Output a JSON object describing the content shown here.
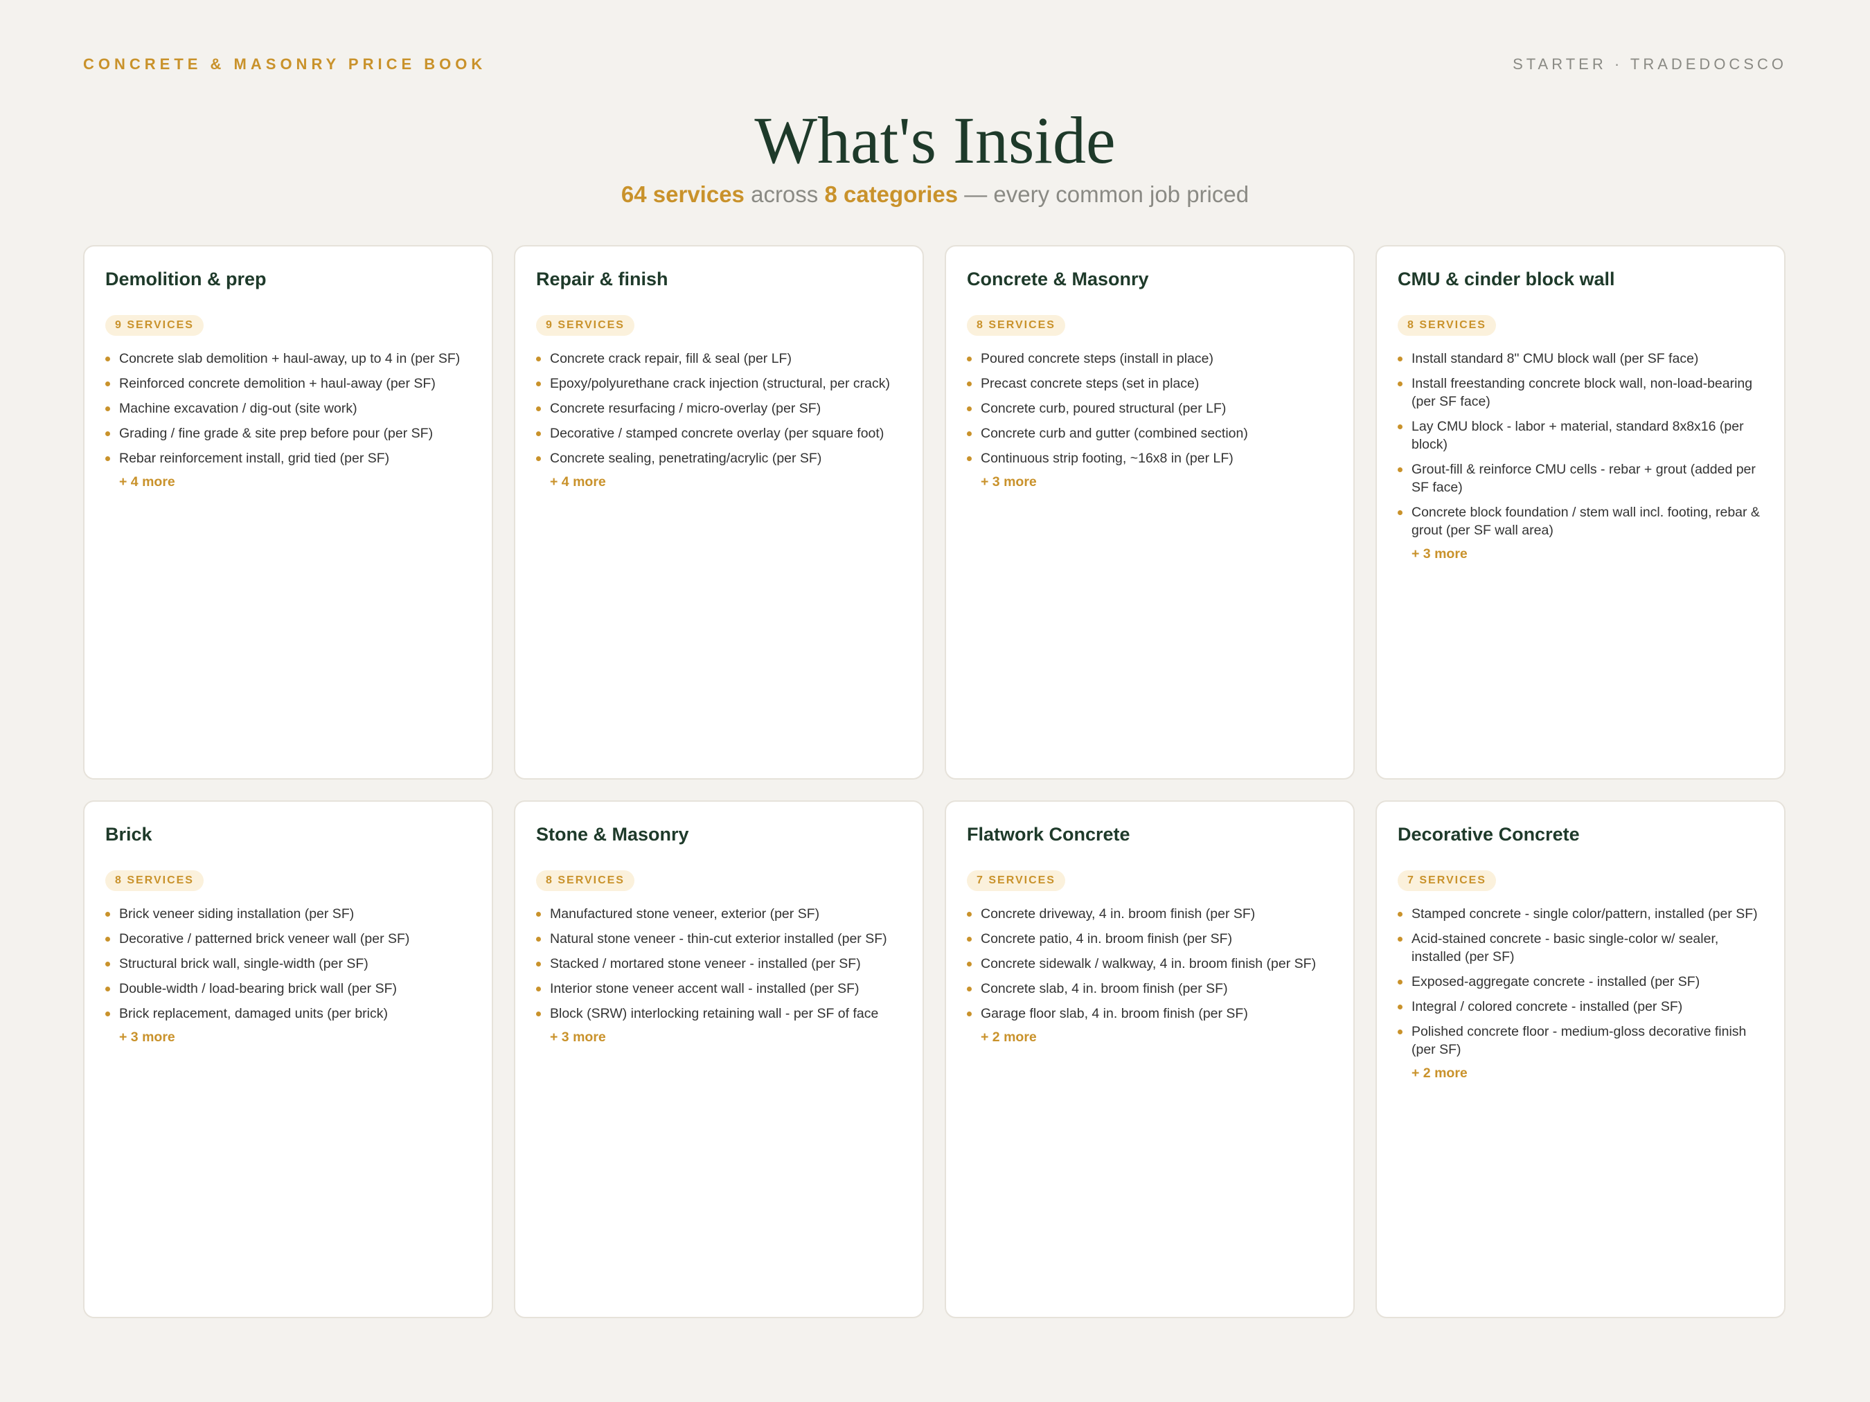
{
  "header": {
    "left": "CONCRETE & MASONRY PRICE BOOK",
    "right": "STARTER · TRADEDOCSCO"
  },
  "title": "What's Inside",
  "subtitle": {
    "services": "64 services",
    "across": " across ",
    "categories": "8 categories",
    "rest": " — every common job priced"
  },
  "accent_color": "#c9922b",
  "heading_color": "#1e3a2a",
  "cards": [
    {
      "title": "Demolition & prep",
      "badge": "9 SERVICES",
      "items": [
        "Concrete slab demolition + haul-away, up to 4 in (per SF)",
        "Reinforced concrete demolition + haul-away (per SF)",
        "Machine excavation / dig-out (site work)",
        "Grading / fine grade & site prep before pour (per SF)",
        "Rebar reinforcement install, grid tied (per SF)"
      ],
      "more": "+ 4 more"
    },
    {
      "title": "Repair & finish",
      "badge": "9 SERVICES",
      "items": [
        "Concrete crack repair, fill & seal (per LF)",
        "Epoxy/polyurethane crack injection (structural, per crack)",
        "Concrete resurfacing / micro-overlay (per SF)",
        "Decorative / stamped concrete overlay (per square foot)",
        "Concrete sealing, penetrating/acrylic (per SF)"
      ],
      "more": "+ 4 more"
    },
    {
      "title": "Concrete & Masonry",
      "badge": "8 SERVICES",
      "items": [
        "Poured concrete steps (install in place)",
        "Precast concrete steps (set in place)",
        "Concrete curb, poured structural (per LF)",
        "Concrete curb and gutter (combined section)",
        "Continuous strip footing, ~16x8 in (per LF)"
      ],
      "more": "+ 3 more"
    },
    {
      "title": "CMU & cinder block wall",
      "badge": "8 SERVICES",
      "items": [
        "Install standard 8\" CMU block wall (per SF face)",
        "Install freestanding concrete block wall, non-load-bearing (per SF face)",
        "Lay CMU block - labor + material, standard 8x8x16 (per block)",
        "Grout-fill & reinforce CMU cells - rebar + grout (added per SF face)",
        "Concrete block foundation / stem wall incl. footing, rebar & grout (per SF wall area)"
      ],
      "more": "+ 3 more"
    },
    {
      "title": "Brick",
      "badge": "8 SERVICES",
      "items": [
        "Brick veneer siding installation (per SF)",
        "Decorative / patterned brick veneer wall (per SF)",
        "Structural brick wall, single-width (per SF)",
        "Double-width / load-bearing brick wall (per SF)",
        "Brick replacement, damaged units (per brick)"
      ],
      "more": "+ 3 more"
    },
    {
      "title": "Stone & Masonry",
      "badge": "8 SERVICES",
      "items": [
        "Manufactured stone veneer, exterior (per SF)",
        "Natural stone veneer - thin-cut exterior installed (per SF)",
        "Stacked / mortared stone veneer - installed (per SF)",
        "Interior stone veneer accent wall - installed (per SF)",
        "Block (SRW) interlocking retaining wall - per SF of face"
      ],
      "more": "+ 3 more"
    },
    {
      "title": "Flatwork Concrete",
      "badge": "7 SERVICES",
      "items": [
        "Concrete driveway, 4 in. broom finish (per SF)",
        "Concrete patio, 4 in. broom finish (per SF)",
        "Concrete sidewalk / walkway, 4 in. broom finish (per SF)",
        "Concrete slab, 4 in. broom finish (per SF)",
        "Garage floor slab, 4 in. broom finish (per SF)"
      ],
      "more": "+ 2 more"
    },
    {
      "title": "Decorative Concrete",
      "badge": "7 SERVICES",
      "items": [
        "Stamped concrete - single color/pattern, installed (per SF)",
        "Acid-stained concrete - basic single-color w/ sealer, installed (per SF)",
        "Exposed-aggregate concrete - installed (per SF)",
        "Integral / colored concrete - installed (per SF)",
        "Polished concrete floor - medium-gloss decorative finish (per SF)"
      ],
      "more": "+ 2 more"
    }
  ]
}
